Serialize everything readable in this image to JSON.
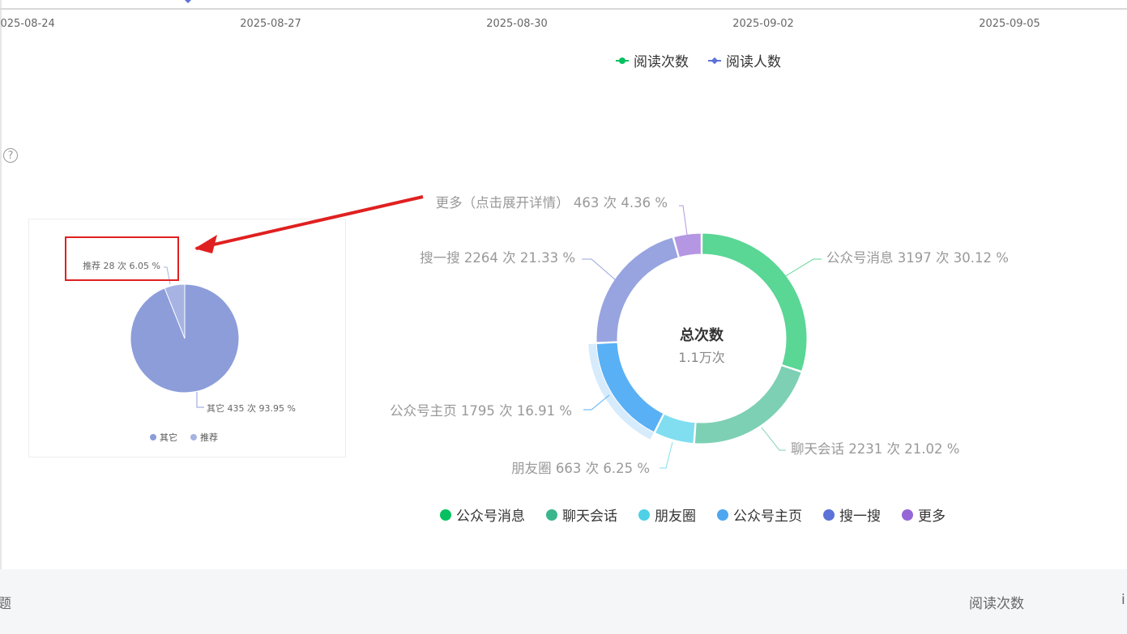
{
  "axis": {
    "dates": [
      "2025-08-24",
      "2025-08-27",
      "2025-08-30",
      "2025-09-02",
      "2025-09-05"
    ]
  },
  "line_legend": [
    {
      "label": "阅读次数",
      "color": "#07c160",
      "symbol": "circle"
    },
    {
      "label": "阅读人数",
      "color": "#5b72d8",
      "symbol": "diamond"
    }
  ],
  "chart_data": [
    {
      "type": "pie",
      "categories": [
        "其它",
        "推荐"
      ],
      "values": [
        435,
        28
      ],
      "percents": [
        93.95,
        6.05
      ],
      "labels": [
        "其它 435 次 93.95 %",
        "推荐 28 次 6.05 %"
      ],
      "colors": [
        "#8c9dda",
        "#a6b3e3"
      ],
      "legend": [
        "其它",
        "推荐"
      ]
    },
    {
      "type": "pie",
      "subtype": "donut",
      "categories": [
        "公众号消息",
        "聊天会话",
        "朋友圈",
        "公众号主页",
        "搜一搜",
        "更多"
      ],
      "values": [
        3197,
        2231,
        663,
        1795,
        2264,
        463
      ],
      "percents": [
        30.12,
        21.02,
        6.25,
        16.91,
        21.33,
        4.36
      ],
      "labels": [
        "公众号消息 3197 次 30.12 %",
        "聊天会话 2231 次 21.02 %",
        "朋友圈 663 次 6.25 %",
        "公众号主页 1795 次 16.91 %",
        "搜一搜 2264 次 21.33 %",
        "更多（点击展开详情） 463 次 4.36 %"
      ],
      "colors": [
        "#5ad695",
        "#7dd0b3",
        "#80def0",
        "#5ab0f5",
        "#97a4e0",
        "#b596e2"
      ],
      "legend_colors": [
        "#07c160",
        "#3bb58c",
        "#4fd0e6",
        "#4ea6f0",
        "#5b72d8",
        "#9567d6"
      ],
      "highlighted": "公众号主页",
      "center_title": "总次数",
      "center_value": "1.1万次"
    }
  ],
  "table": {
    "left_header": "题",
    "right_header": "阅读次数",
    "edge_header": "i"
  },
  "icons": {
    "help": "question-circle-icon",
    "help_glyph": "?"
  }
}
